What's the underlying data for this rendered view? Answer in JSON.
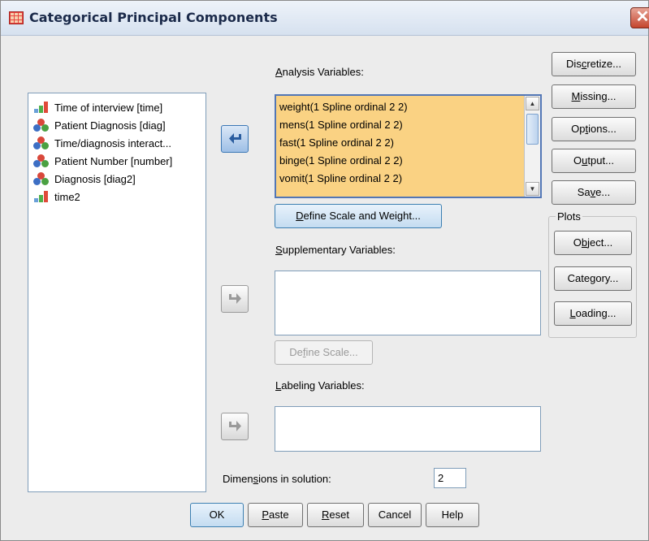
{
  "window": {
    "title": "Categorical Principal Components",
    "close_glyph": "✕"
  },
  "source_variables": [
    {
      "label": "Time of interview [time]",
      "icon": "scale-bars-icon"
    },
    {
      "label": "Patient Diagnosis [diag]",
      "icon": "nominal-icon"
    },
    {
      "label": "Time/diagnosis interact...",
      "icon": "nominal-icon"
    },
    {
      "label": "Patient Number [number]",
      "icon": "nominal-icon"
    },
    {
      "label": "Diagnosis [diag2]",
      "icon": "nominal-icon"
    },
    {
      "label": "time2",
      "icon": "scale-bars-icon"
    }
  ],
  "analysis": {
    "label_pre": "",
    "label_u": "A",
    "label_post": "nalysis Variables:",
    "items": [
      "weight(1 Spline ordinal 2 2)",
      "mens(1 Spline ordinal 2 2)",
      "fast(1 Spline ordinal 2 2)",
      "binge(1 Spline ordinal 2 2)",
      "vomit(1 Spline ordinal 2 2)"
    ],
    "define_pre": "",
    "define_u": "D",
    "define_post": "efine Scale and Weight..."
  },
  "supplementary": {
    "label_pre": "",
    "label_u": "S",
    "label_post": "upplementary Variables:",
    "define_pre": "De",
    "define_u": "f",
    "define_post": "ine Scale..."
  },
  "labeling": {
    "label_pre": "",
    "label_u": "L",
    "label_post": "abeling Variables:"
  },
  "dimensions": {
    "label_pre": "Dimen",
    "label_u": "s",
    "label_post": "ions in solution:",
    "value": "2"
  },
  "side_buttons": [
    {
      "pre": "Dis",
      "u": "c",
      "post": "retize..."
    },
    {
      "pre": "",
      "u": "M",
      "post": "issing..."
    },
    {
      "pre": "Op",
      "u": "t",
      "post": "ions..."
    },
    {
      "pre": "O",
      "u": "u",
      "post": "tput..."
    },
    {
      "pre": "Sa",
      "u": "v",
      "post": "e..."
    }
  ],
  "plots": {
    "legend": "Plots",
    "buttons": [
      {
        "pre": "O",
        "u": "b",
        "post": "ject..."
      },
      {
        "pre": "Cate",
        "u": "g",
        "post": "ory..."
      },
      {
        "pre": "",
        "u": "L",
        "post": "oading..."
      }
    ]
  },
  "bottom_buttons": [
    {
      "pre": "OK",
      "u": "",
      "post": ""
    },
    {
      "pre": "",
      "u": "P",
      "post": "aste"
    },
    {
      "pre": "",
      "u": "R",
      "post": "eset"
    },
    {
      "pre": "Cancel",
      "u": "",
      "post": ""
    },
    {
      "pre": "Help",
      "u": "",
      "post": ""
    }
  ],
  "colors": {
    "analysis_fill": "#fad283",
    "selection_border": "#5276b5",
    "arrow_active": "#2a5d9f"
  }
}
